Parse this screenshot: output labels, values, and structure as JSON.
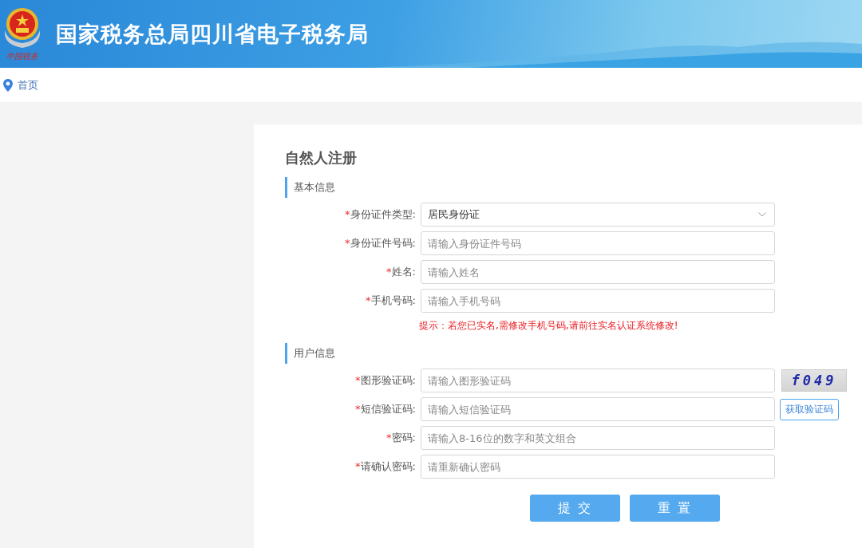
{
  "header": {
    "logo_text": "中国税务",
    "title": "国家税务总局四川省电子税务局"
  },
  "breadcrumb": {
    "label": "首页"
  },
  "form": {
    "title": "自然人注册",
    "sections": [
      {
        "title": "基本信息",
        "fields": [
          {
            "kind": "select",
            "marker": "*",
            "label": "身份证件类型:",
            "value": "居民身份证"
          },
          {
            "kind": "input",
            "marker": "*",
            "label": "身份证件号码:",
            "placeholder": "请输入身份证件号码"
          },
          {
            "kind": "input",
            "marker": "*",
            "label": "姓名:",
            "placeholder": "请输入姓名"
          },
          {
            "kind": "input",
            "marker": "*",
            "label": "手机号码:",
            "placeholder": "请输入手机号码"
          }
        ],
        "notice": "提示：若您已实名,需修改手机号码,请前往实名认证系统修改!"
      },
      {
        "title": "用户信息",
        "fields": [
          {
            "kind": "input",
            "marker": "*",
            "label": "图形验证码:",
            "placeholder": "请输入图形验证码",
            "addon": {
              "kind": "captcha",
              "text": "f049"
            }
          },
          {
            "kind": "input",
            "marker": "*",
            "label": "短信验证码:",
            "placeholder": "请输入短信验证码",
            "addon": {
              "kind": "button",
              "text": "获取验证码"
            }
          },
          {
            "kind": "input",
            "marker": "*",
            "label": "密码:",
            "placeholder": "请输入8-16位的数字和英文组合"
          },
          {
            "kind": "input",
            "marker": "*",
            "label": "请确认密码:",
            "placeholder": "请重新确认密码"
          }
        ]
      }
    ],
    "buttons": [
      "提 交",
      "重 置"
    ]
  }
}
